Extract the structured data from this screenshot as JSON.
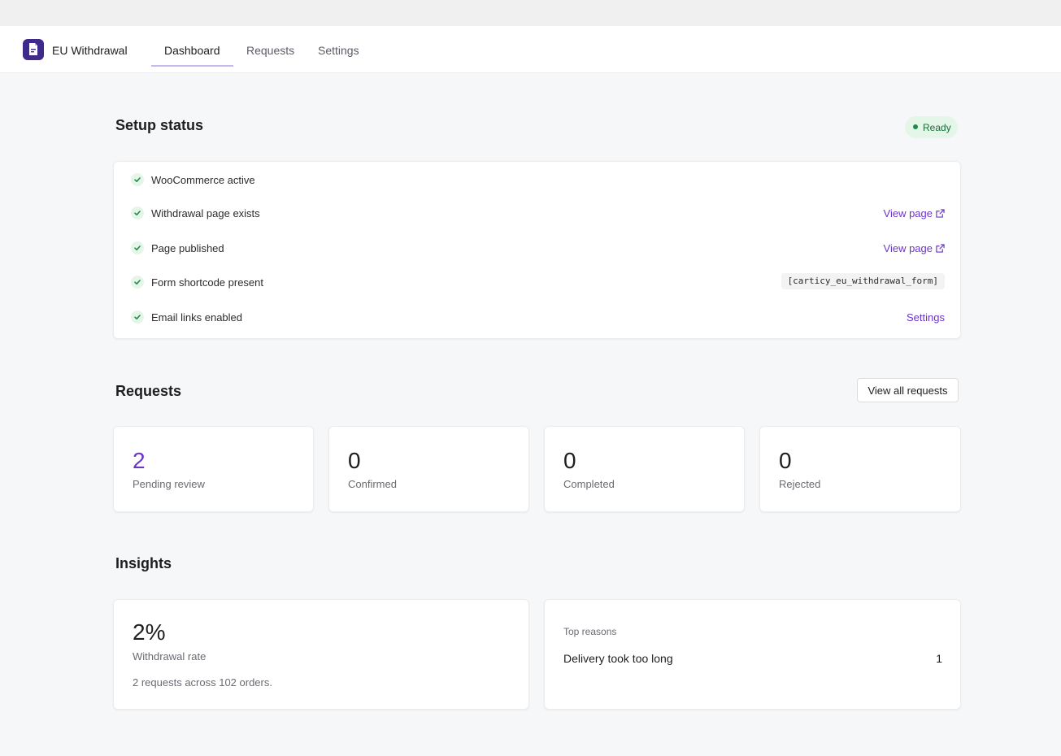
{
  "app": {
    "title": "EU Withdrawal"
  },
  "tabs": [
    {
      "label": "Dashboard",
      "active": true
    },
    {
      "label": "Requests",
      "active": false
    },
    {
      "label": "Settings",
      "active": false
    }
  ],
  "setup": {
    "title": "Setup status",
    "badge": "Ready",
    "items": [
      {
        "label": "WooCommerce active"
      },
      {
        "label": "Withdrawal page exists",
        "link": "View page"
      },
      {
        "label": "Page published",
        "link": "View page"
      },
      {
        "label": "Form shortcode present",
        "code": "[carticy_eu_withdrawal_form]"
      },
      {
        "label": "Email links enabled",
        "link": "Settings"
      }
    ]
  },
  "requests": {
    "title": "Requests",
    "view_all_label": "View all requests",
    "stats": [
      {
        "value": "2",
        "label": "Pending review"
      },
      {
        "value": "0",
        "label": "Confirmed"
      },
      {
        "value": "0",
        "label": "Completed"
      },
      {
        "value": "0",
        "label": "Rejected"
      }
    ]
  },
  "insights": {
    "title": "Insights",
    "rate_value": "2%",
    "rate_label": "Withdrawal rate",
    "rate_note": "2 requests across 102 orders.",
    "reasons_title": "Top reasons",
    "reasons": [
      {
        "label": "Delivery took too long",
        "count": "1"
      }
    ]
  },
  "colors": {
    "accent": "#6b35c8",
    "brand": "#3f2a8c",
    "success": "#1f8a4c",
    "success_bg": "#e3f6e8"
  }
}
